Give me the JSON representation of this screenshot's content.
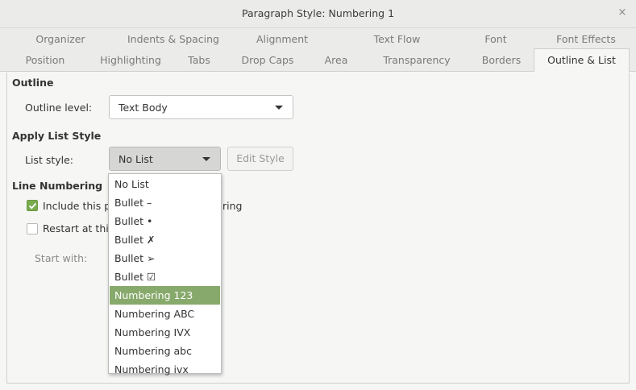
{
  "window": {
    "title": "Paragraph Style: Numbering 1",
    "close_glyph": "×"
  },
  "tabs_row1": [
    "Organizer",
    "Indents & Spacing",
    "Alignment",
    "Text Flow",
    "Font",
    "Font Effects"
  ],
  "tabs_row2": [
    "Position",
    "Highlighting",
    "Tabs",
    "Drop Caps",
    "Area",
    "Transparency",
    "Borders",
    "Outline & List"
  ],
  "active_tab": "Outline & List",
  "outline": {
    "heading": "Outline",
    "level_label": "Outline level:",
    "level_value": "Text Body"
  },
  "list_style": {
    "heading": "Apply List Style",
    "label": "List style:",
    "value": "No List",
    "edit_button": "Edit Style"
  },
  "line_numbering": {
    "heading": "Line Numbering",
    "include_label_visible_left": "Include this p",
    "include_label_visible_right": "ring",
    "include_checked": true,
    "restart_label_visible": "Restart at this",
    "restart_checked": false,
    "start_with_label": "Start with:"
  },
  "dropdown": {
    "items": [
      "No List",
      "Bullet –",
      "Bullet •",
      "Bullet ✗",
      "Bullet ➢",
      "Bullet ☑",
      "Numbering 123",
      "Numbering ABC",
      "Numbering IVX",
      "Numbering abc",
      "Numbering ivx"
    ],
    "highlighted": "Numbering 123"
  },
  "colors": {
    "accent": "#87a96b",
    "checkbox": "#7aac4f"
  }
}
